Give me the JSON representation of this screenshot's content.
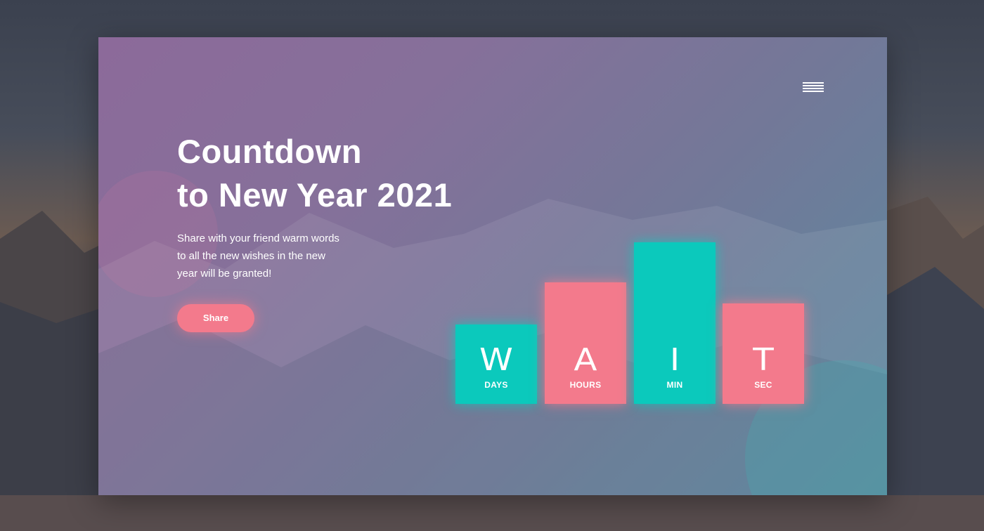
{
  "menu": {
    "icon": "hamburger-menu-icon"
  },
  "hero": {
    "title_line1": "Countdown",
    "title_line2": "to New Year 2021",
    "subtitle_line1": "Share with your friend warm words",
    "subtitle_line2": "to all the new wishes in the new",
    "subtitle_line3": "year will be granted!",
    "share_label": "Share"
  },
  "countdown": {
    "bars": [
      {
        "letter": "W",
        "unit": "DAYS",
        "color": "#0bc9bc",
        "level": 0.49
      },
      {
        "letter": "A",
        "unit": "HOURS",
        "color": "#f37a8c",
        "level": 0.75
      },
      {
        "letter": "I",
        "unit": "MIN",
        "color": "#0bc9bc",
        "level": 1.0
      },
      {
        "letter": "T",
        "unit": "SEC",
        "color": "#f37a8c",
        "level": 0.62
      }
    ]
  },
  "colors": {
    "accent_pink": "#f37a8c",
    "accent_teal": "#0bc9bc",
    "card_top": "#8c6a9a",
    "card_bottom": "#5a8aa0"
  }
}
